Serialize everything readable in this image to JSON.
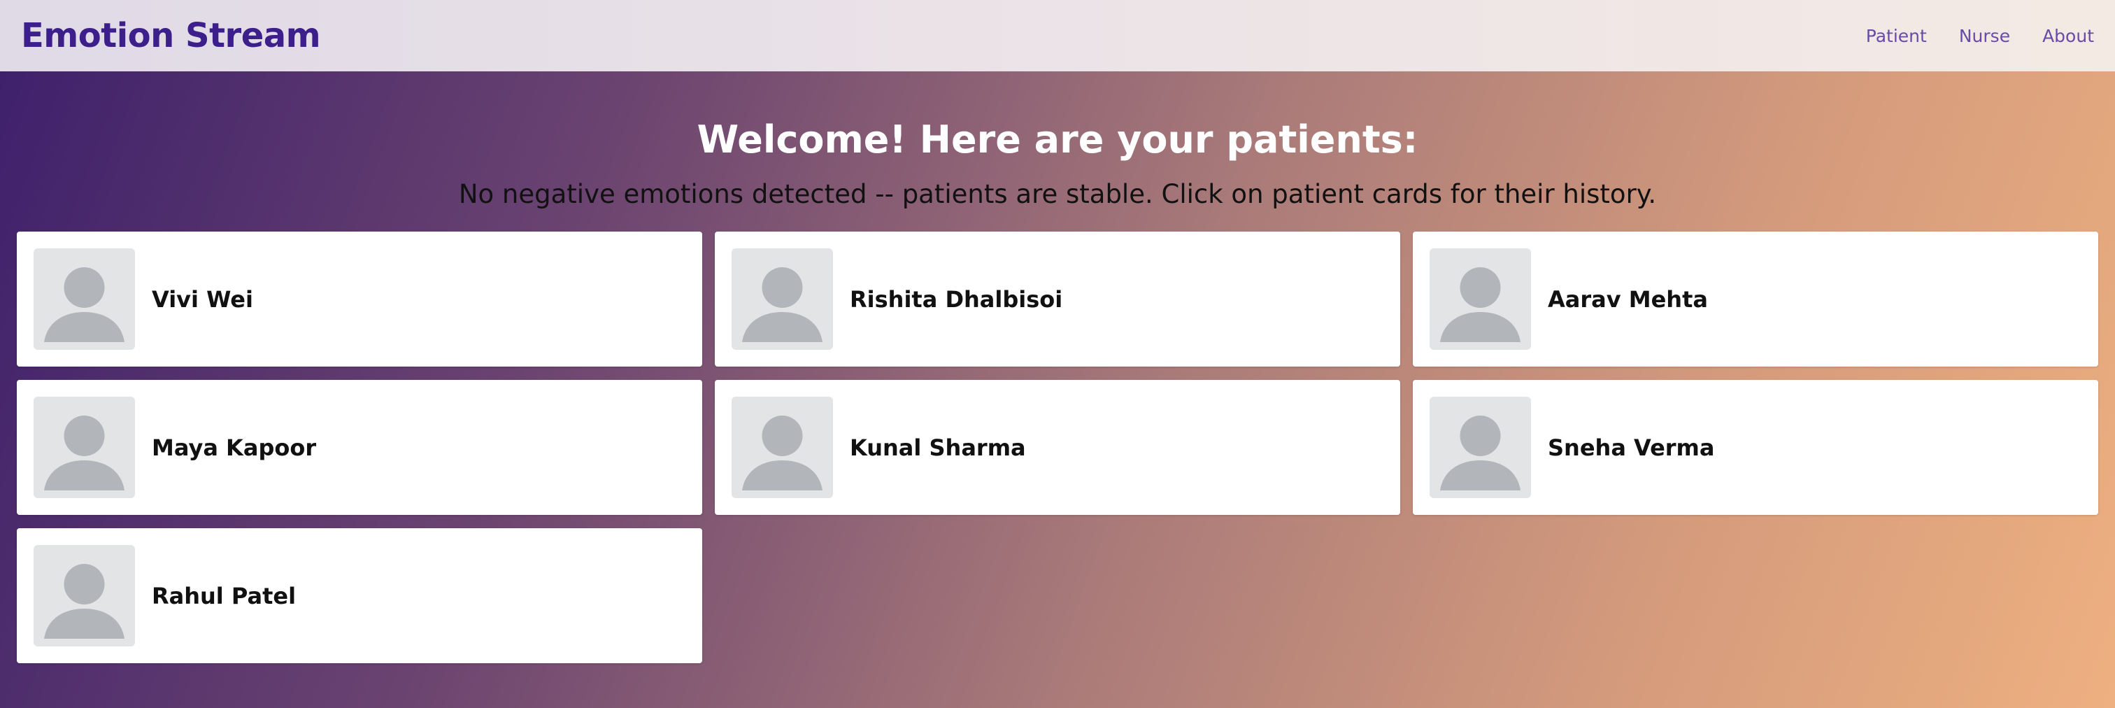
{
  "navbar": {
    "brand": "Emotion Stream",
    "links": [
      {
        "label": "Patient"
      },
      {
        "label": "Nurse"
      },
      {
        "label": "About"
      }
    ]
  },
  "main": {
    "heading": "Welcome! Here are your patients:",
    "subheading": "No negative emotions detected -- patients are stable. Click on patient cards for their history."
  },
  "patients": [
    {
      "name": "Vivi Wei",
      "icon": "user-avatar-icon"
    },
    {
      "name": "Rishita Dhalbisoi",
      "icon": "user-avatar-icon"
    },
    {
      "name": "Aarav Mehta",
      "icon": "user-avatar-icon"
    },
    {
      "name": "Maya Kapoor",
      "icon": "user-avatar-icon"
    },
    {
      "name": "Kunal Sharma",
      "icon": "user-avatar-icon"
    },
    {
      "name": "Sneha Verma",
      "icon": "user-avatar-icon"
    },
    {
      "name": "Rahul Patel",
      "icon": "user-avatar-icon"
    }
  ],
  "colors": {
    "brand": "#3d1f8c",
    "nav_link": "#6a4aa8",
    "avatar_bg": "#e3e4e6",
    "avatar_fg": "#b2b5ba"
  }
}
